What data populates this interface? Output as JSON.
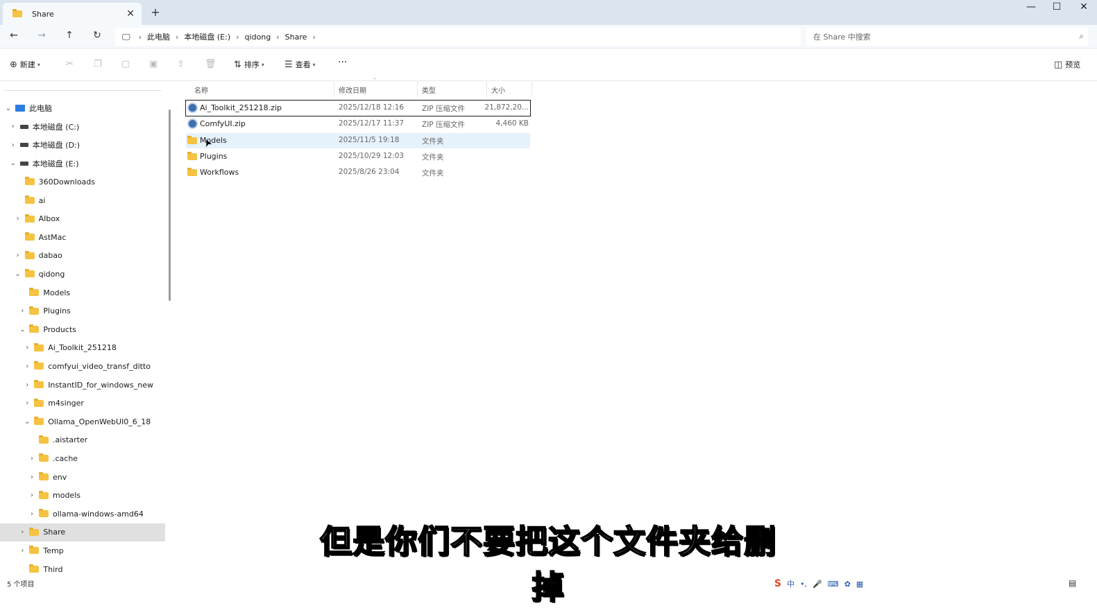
{
  "window": {
    "tab_title": "Share",
    "tab_close": "✕",
    "new_tab": "+",
    "controls": {
      "minimize": "—",
      "maximize": "☐",
      "close": "✕"
    }
  },
  "nav": {
    "back": "←",
    "forward": "→",
    "up": "↑",
    "refresh": "↻"
  },
  "breadcrumb": [
    "此电脑",
    "本地磁盘 (E:)",
    "qidong",
    "Share"
  ],
  "search": {
    "placeholder": "在 Share 中搜索"
  },
  "toolbar": {
    "new_label": "新建",
    "sort_label": "排序",
    "view_label": "查看",
    "more": "···",
    "preview_label": "预览"
  },
  "sidebar": {
    "items": [
      {
        "label": "此电脑",
        "type": "pc",
        "indent": 0,
        "chevron": "open"
      },
      {
        "label": "本地磁盘 (C:)",
        "type": "drive",
        "indent": 1,
        "chevron": "closed"
      },
      {
        "label": "本地磁盘 (D:)",
        "type": "drive",
        "indent": 1,
        "chevron": "closed"
      },
      {
        "label": "本地磁盘 (E:)",
        "type": "drive",
        "indent": 1,
        "chevron": "open"
      },
      {
        "label": "360Downloads",
        "type": "folder",
        "indent": 2,
        "chevron": "none"
      },
      {
        "label": "ai",
        "type": "folder",
        "indent": 2,
        "chevron": "none"
      },
      {
        "label": "AIbox",
        "type": "folder",
        "indent": 2,
        "chevron": "closed"
      },
      {
        "label": "AstMac",
        "type": "folder",
        "indent": 2,
        "chevron": "none"
      },
      {
        "label": "dabao",
        "type": "folder",
        "indent": 2,
        "chevron": "closed"
      },
      {
        "label": "qidong",
        "type": "folder",
        "indent": 2,
        "chevron": "open"
      },
      {
        "label": "Models",
        "type": "folder",
        "indent": 3,
        "chevron": "none"
      },
      {
        "label": "Plugins",
        "type": "folder",
        "indent": 3,
        "chevron": "closed"
      },
      {
        "label": "Products",
        "type": "folder",
        "indent": 3,
        "chevron": "open"
      },
      {
        "label": "Ai_Toolkit_251218",
        "type": "folder",
        "indent": 4,
        "chevron": "closed"
      },
      {
        "label": "comfyui_video_transf_ditto",
        "type": "folder",
        "indent": 4,
        "chevron": "closed"
      },
      {
        "label": "InstantID_for_windows_new",
        "type": "folder",
        "indent": 4,
        "chevron": "closed"
      },
      {
        "label": "m4singer",
        "type": "folder",
        "indent": 4,
        "chevron": "closed"
      },
      {
        "label": "Ollama_OpenWebUI0_6_18",
        "type": "folder",
        "indent": 4,
        "chevron": "open"
      },
      {
        "label": ".aistarter",
        "type": "folder",
        "indent": 5,
        "chevron": "none"
      },
      {
        "label": ".cache",
        "type": "folder",
        "indent": 5,
        "chevron": "closed"
      },
      {
        "label": "env",
        "type": "folder",
        "indent": 5,
        "chevron": "closed"
      },
      {
        "label": "models",
        "type": "folder",
        "indent": 5,
        "chevron": "closed"
      },
      {
        "label": "ollama-windows-amd64",
        "type": "folder",
        "indent": 5,
        "chevron": "closed"
      },
      {
        "label": "Share",
        "type": "folder",
        "indent": 3,
        "chevron": "closed",
        "selected": true
      },
      {
        "label": "Temp",
        "type": "folder",
        "indent": 3,
        "chevron": "closed"
      },
      {
        "label": "Third",
        "type": "folder",
        "indent": 3,
        "chevron": "none"
      }
    ]
  },
  "columns": {
    "name": "名称",
    "date": "修改日期",
    "type": "类型",
    "size": "大小"
  },
  "files": [
    {
      "name": "Ai_Toolkit_251218.zip",
      "date": "2025/12/18 12:16",
      "type": "ZIP 压缩文件",
      "size": "21,872,20...",
      "kind": "zip",
      "focused": true
    },
    {
      "name": "ComfyUI.zip",
      "date": "2025/12/17 11:37",
      "type": "ZIP 压缩文件",
      "size": "4,460 KB",
      "kind": "zip"
    },
    {
      "name": "Models",
      "date": "2025/11/5 19:18",
      "type": "文件夹",
      "size": "",
      "kind": "folder",
      "hover": true
    },
    {
      "name": "Plugins",
      "date": "2025/10/29 12:03",
      "type": "文件夹",
      "size": "",
      "kind": "folder"
    },
    {
      "name": "Workflows",
      "date": "2025/8/26 23:04",
      "type": "文件夹",
      "size": "",
      "kind": "folder"
    }
  ],
  "status": {
    "item_count": "5 个项目"
  },
  "ime": {
    "label": "中"
  },
  "subtitle": "但是你们不要把这个文件夹给删掉",
  "colors": {
    "accent": "#2d7de0",
    "folder": "#f5c242",
    "selected_bg": "#e0e0e0",
    "hover_bg": "#e5f1fb"
  }
}
